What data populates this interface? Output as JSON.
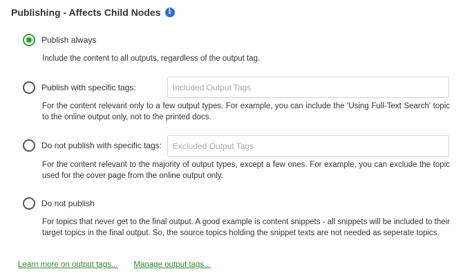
{
  "section": {
    "title": "Publishing - Affects Child Nodes",
    "info_icon": "i"
  },
  "options": [
    {
      "label": "Publish always",
      "selected": true,
      "description": "Include the content to all outputs, regardless of the output tag."
    },
    {
      "label": "Publish with specific tags:",
      "selected": false,
      "input_placeholder": "Included Output Tags",
      "input_value": "",
      "description": "For the content relevant only to a few output types. For example, you can include the 'Using Full-Text Search' topic to the online output only, not to the printed docs."
    },
    {
      "label": "Do not publish with specific tags:",
      "selected": false,
      "input_placeholder": "Excluded Output Tags",
      "input_value": "",
      "description": "For the content relevant to the majority of output types, except a few ones. For example, you can exclude the topic used for the cover page from the online output only."
    },
    {
      "label": "Do not publish",
      "selected": false,
      "description": "For topics that never get to the final output. A good example is content snippets - all snippets will be included to their target topics in the final output. So, the source topics holding the snippet texts are not needed as seperate topics."
    }
  ],
  "links": {
    "learn_more": "Learn more on output tags...",
    "manage": "Manage output tags..."
  },
  "colors": {
    "accent_green": "#2e9e2e",
    "info_blue": "#2f6fd6"
  }
}
